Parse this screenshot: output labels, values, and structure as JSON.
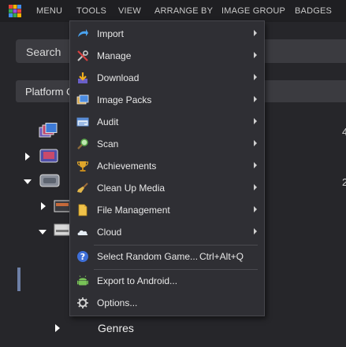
{
  "menubar": {
    "items": [
      "MENU",
      "TOOLS",
      "VIEW",
      "ARRANGE BY",
      "IMAGE GROUP",
      "BADGES"
    ]
  },
  "search": {
    "label": "Search"
  },
  "platform": {
    "label": "Platform C"
  },
  "counts": [
    "4",
    "2"
  ],
  "tree": {
    "genres_label": "Genres"
  },
  "tools_menu": {
    "items": [
      {
        "label": "Import",
        "icon": "import-arrow-icon",
        "submenu": true
      },
      {
        "label": "Manage",
        "icon": "tools-icon",
        "submenu": true
      },
      {
        "label": "Download",
        "icon": "download-icon",
        "submenu": true
      },
      {
        "label": "Image Packs",
        "icon": "image-packs-icon",
        "submenu": true
      },
      {
        "label": "Audit",
        "icon": "audit-icon",
        "submenu": true
      },
      {
        "label": "Scan",
        "icon": "scan-magnifier-icon",
        "submenu": true
      },
      {
        "label": "Achievements",
        "icon": "trophy-icon",
        "submenu": true
      },
      {
        "label": "Clean Up Media",
        "icon": "broom-icon",
        "submenu": true
      },
      {
        "label": "File Management",
        "icon": "file-icon",
        "submenu": true
      },
      {
        "label": "Cloud",
        "icon": "cloud-icon",
        "submenu": true
      },
      {
        "label": "Select Random Game...",
        "icon": "question-icon",
        "shortcut": "Ctrl+Alt+Q"
      },
      {
        "label": "Export to Android...",
        "icon": "android-icon"
      },
      {
        "label": "Options...",
        "icon": "gear-icon"
      }
    ]
  },
  "colors": {
    "background": "#26262a",
    "menubar": "#1f1f22",
    "dropdown": "#2f2f34",
    "selection_accent": "#6d7fa6"
  }
}
